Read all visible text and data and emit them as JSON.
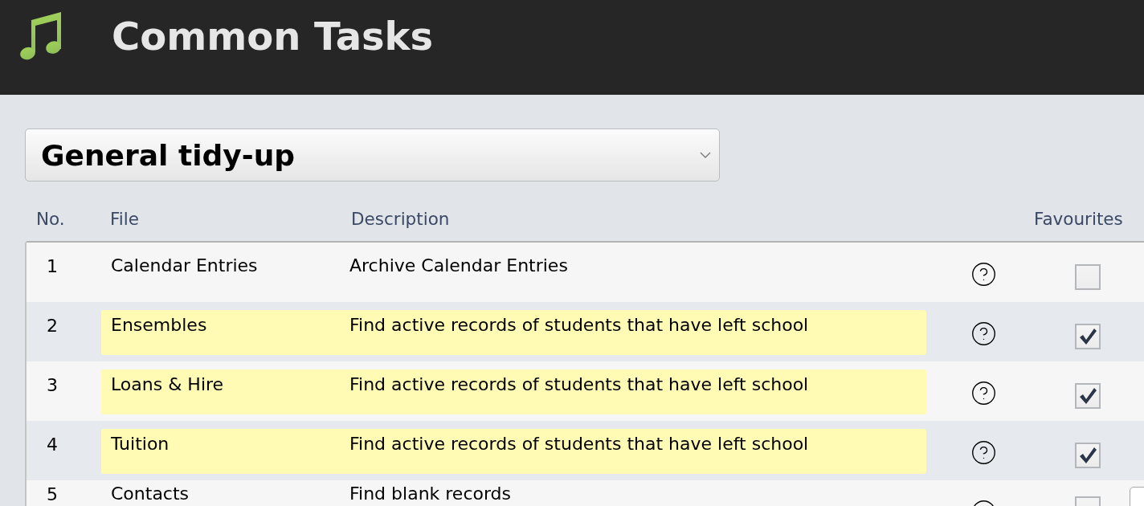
{
  "header": {
    "title": "Common Tasks"
  },
  "category_select": {
    "value": "General tidy-up"
  },
  "table": {
    "columns": [
      "No.",
      "File",
      "Description",
      "Favourites"
    ],
    "rows": [
      {
        "number": "1",
        "file": "Calendar Entries",
        "description": "Archive Calendar Entries",
        "highlighted": false,
        "favourite": false
      },
      {
        "number": "2",
        "file": "Ensembles",
        "description": "Find active records of students that have left school",
        "highlighted": true,
        "favourite": true
      },
      {
        "number": "3",
        "file": "Loans & Hire",
        "description": "Find active records of students that have left school",
        "highlighted": true,
        "favourite": true
      },
      {
        "number": "4",
        "file": "Tuition",
        "description": "Find active records of students that have left school",
        "highlighted": true,
        "favourite": true
      },
      {
        "number": "5",
        "file": "Contacts",
        "description": "Find blank records",
        "highlighted": false,
        "favourite": false
      }
    ]
  }
}
